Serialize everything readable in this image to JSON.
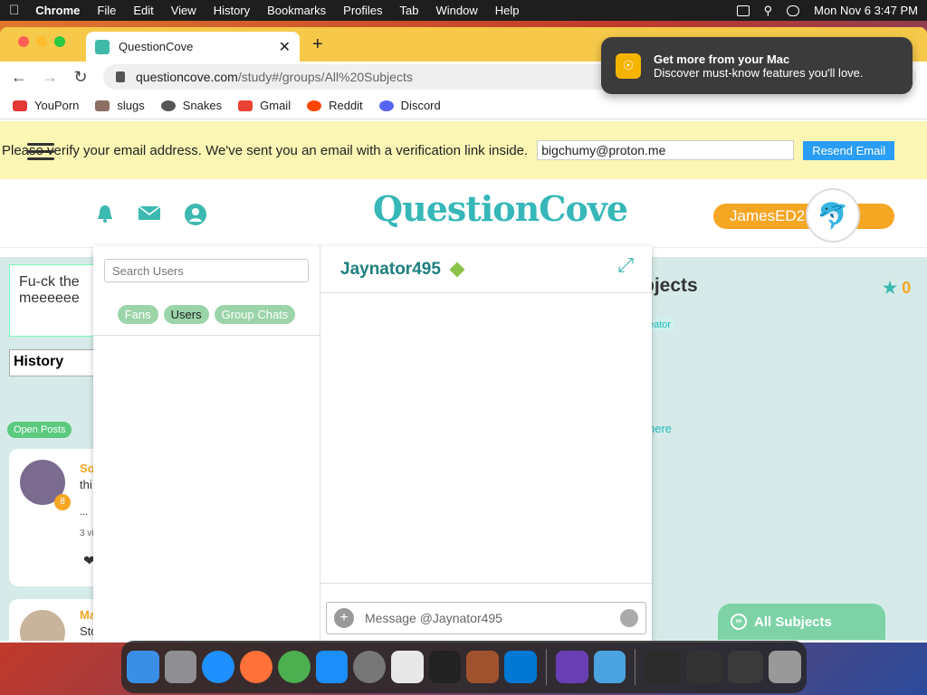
{
  "menubar": {
    "apple_icon": "apple-icon",
    "app_name": "Chrome",
    "items": [
      "File",
      "Edit",
      "View",
      "History",
      "Bookmarks",
      "Profiles",
      "Tab",
      "Window",
      "Help"
    ],
    "clock": "Mon Nov 6  3:47 PM"
  },
  "browser": {
    "tab_title": "QuestionCove",
    "url_domain": "questioncove.com",
    "url_path": "/study#/groups/All%20Subjects",
    "bookmarks": [
      {
        "label": "YouPorn",
        "color": "#e53935"
      },
      {
        "label": "slugs",
        "color": "#8d6e63"
      },
      {
        "label": "Snakes",
        "color": "#555555"
      },
      {
        "label": "Gmail",
        "color": "#ea4335"
      },
      {
        "label": "Reddit",
        "color": "#ff4500"
      },
      {
        "label": "Discord",
        "color": "#5865f2"
      }
    ]
  },
  "notification": {
    "title": "Get more from your Mac",
    "body": "Discover must-know features you'll love."
  },
  "verify_bar": {
    "message": "Please verify your email address. We've sent you an email with a verification link inside.",
    "email_value": "bigchumy@proton.me",
    "resend_label": "Resend Email"
  },
  "header": {
    "logo_text": "QuestionCove",
    "username": "JamesED2"
  },
  "left": {
    "post_text": "Fu-ck the meeeeee",
    "history_label": "History",
    "open_posts_label": "Open Posts",
    "post1_author": "So",
    "post1_text": "thi",
    "post1_meta": "3 vi",
    "post1_badge": "8",
    "post1_ellipsis": "...",
    "post2_author": "Ma",
    "post2_text": "Sto"
  },
  "right": {
    "subjects_title": "bjects",
    "score": "0",
    "creator_tag": "eator",
    "here_link": "here",
    "all_subjects_label": "All Subjects"
  },
  "chat": {
    "search_placeholder": "Search Users",
    "filters": [
      "Fans",
      "Users",
      "Group Chats"
    ],
    "active_filter": "Users",
    "contact_name": "Jaynator495",
    "message_placeholder": "Message @Jaynator495"
  }
}
